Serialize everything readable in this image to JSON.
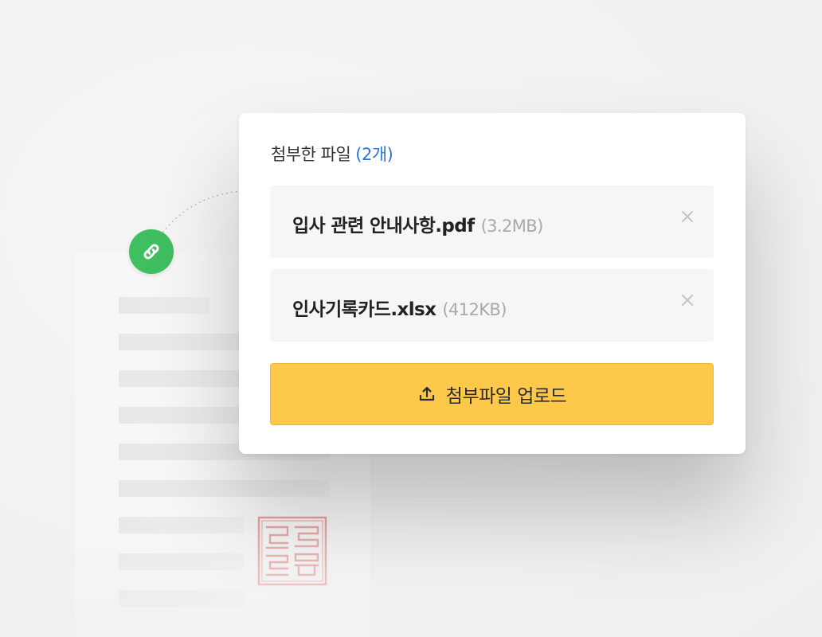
{
  "attachments": {
    "title": "첨부한 파일",
    "count_label": "(2개)",
    "files": [
      {
        "name": "입사 관련 안내사항.pdf",
        "size": "(3.2MB)"
      },
      {
        "name": "인사기록카드.xlsx",
        "size": "(412KB)"
      }
    ],
    "upload_label": "첨부파일 업로드"
  },
  "icons": {
    "link": "link-icon",
    "close": "close-icon",
    "upload": "upload-icon",
    "stamp": "stamp-seal"
  },
  "colors": {
    "accent_blue": "#2b74e0",
    "link_green": "#3fbf5f",
    "upload_yellow": "#fec94b",
    "stamp_red": "#d9534f"
  }
}
